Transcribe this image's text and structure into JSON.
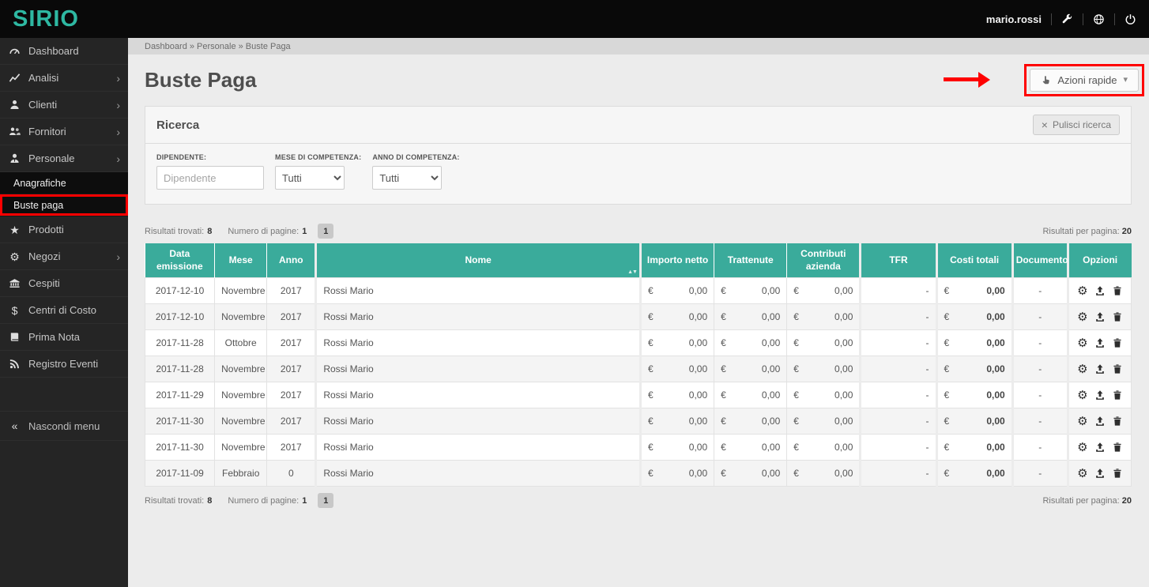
{
  "colors": {
    "accent": "#2eb8a2",
    "table_header": "#3aab9b",
    "annotation": "#fe0000",
    "topbar": "#090909",
    "sidebar": "#252525"
  },
  "topbar": {
    "logo": "SIRIO",
    "username": "mario.rossi",
    "icons": [
      "wrench",
      "globe",
      "power"
    ]
  },
  "breadcrumb": {
    "text": "Dashboard » Personale » Buste Paga"
  },
  "sidebar": {
    "items": [
      {
        "label": "Dashboard",
        "icon": "dashboard"
      },
      {
        "label": "Analisi",
        "icon": "chart",
        "chevron": true
      },
      {
        "label": "Clienti",
        "icon": "user",
        "chevron": true
      },
      {
        "label": "Fornitori",
        "icon": "users",
        "chevron": true
      },
      {
        "label": "Personale",
        "icon": "user-tie",
        "chevron": true
      },
      {
        "label": "Anagrafiche",
        "sub": true
      },
      {
        "label": "Buste paga",
        "sub": true,
        "active": true,
        "annotated": true
      },
      {
        "label": "Prodotti",
        "icon": "star"
      },
      {
        "label": "Negozi",
        "icon": "gears",
        "chevron": true
      },
      {
        "label": "Cespiti",
        "icon": "bank"
      },
      {
        "label": "Centri di Costo",
        "icon": "dollar"
      },
      {
        "label": "Prima Nota",
        "icon": "book"
      },
      {
        "label": "Registro Eventi",
        "icon": "rss"
      }
    ],
    "collapse_label": "Nascondi menu",
    "collapse_icon": "angles-left"
  },
  "page": {
    "title": "Buste Paga",
    "quick_actions_label": "Azioni rapide",
    "quick_actions_icon": "hand"
  },
  "search": {
    "title": "Ricerca",
    "clear_label": "Pulisci ricerca",
    "clear_icon": "x",
    "fields": [
      {
        "label": "DIPENDENTE:",
        "placeholder": "Dipendente",
        "type": "text"
      },
      {
        "label": "MESE DI COMPETENZA:",
        "value": "Tutti",
        "type": "select"
      },
      {
        "label": "ANNO DI COMPETENZA:",
        "value": "Tutti",
        "type": "select"
      }
    ]
  },
  "results": {
    "found_label": "Risultati trovati:",
    "found_value": "8",
    "pages_label": "Numero di pagine:",
    "pages_value": "1",
    "page_button": "1",
    "per_page_label": "Risultati per pagina:",
    "per_page_value": "20"
  },
  "table": {
    "currency": "€",
    "option_icons": [
      "gear",
      "upload",
      "trash"
    ],
    "headers": [
      {
        "label": "Data emissione"
      },
      {
        "label": "Mese"
      },
      {
        "label": "Anno"
      },
      {
        "label": "Nome",
        "sortable": true,
        "sort_glyphs": "▲▼"
      },
      {
        "label": "Importo netto"
      },
      {
        "label": "Trattenute"
      },
      {
        "label": "Contributi azienda"
      },
      {
        "label": "TFR"
      },
      {
        "label": "Costi totali"
      },
      {
        "label": "Documento"
      },
      {
        "label": "Opzioni"
      }
    ],
    "rows": [
      {
        "data_emissione": "2017-12-10",
        "mese": "Novembre",
        "anno": "2017",
        "nome": "Rossi Mario",
        "importo_netto": "0,00",
        "trattenute": "0,00",
        "contributi_azienda": "0,00",
        "tfr": "-",
        "costi_totali": "0,00",
        "documento": "-"
      },
      {
        "data_emissione": "2017-12-10",
        "mese": "Novembre",
        "anno": "2017",
        "nome": "Rossi Mario",
        "importo_netto": "0,00",
        "trattenute": "0,00",
        "contributi_azienda": "0,00",
        "tfr": "-",
        "costi_totali": "0,00",
        "documento": "-"
      },
      {
        "data_emissione": "2017-11-28",
        "mese": "Ottobre",
        "anno": "2017",
        "nome": "Rossi Mario",
        "importo_netto": "0,00",
        "trattenute": "0,00",
        "contributi_azienda": "0,00",
        "tfr": "-",
        "costi_totali": "0,00",
        "documento": "-"
      },
      {
        "data_emissione": "2017-11-28",
        "mese": "Novembre",
        "anno": "2017",
        "nome": "Rossi Mario",
        "importo_netto": "0,00",
        "trattenute": "0,00",
        "contributi_azienda": "0,00",
        "tfr": "-",
        "costi_totali": "0,00",
        "documento": "-"
      },
      {
        "data_emissione": "2017-11-29",
        "mese": "Novembre",
        "anno": "2017",
        "nome": "Rossi Mario",
        "importo_netto": "0,00",
        "trattenute": "0,00",
        "contributi_azienda": "0,00",
        "tfr": "-",
        "costi_totali": "0,00",
        "documento": "-"
      },
      {
        "data_emissione": "2017-11-30",
        "mese": "Novembre",
        "anno": "2017",
        "nome": "Rossi Mario",
        "importo_netto": "0,00",
        "trattenute": "0,00",
        "contributi_azienda": "0,00",
        "tfr": "-",
        "costi_totali": "0,00",
        "documento": "-"
      },
      {
        "data_emissione": "2017-11-30",
        "mese": "Novembre",
        "anno": "2017",
        "nome": "Rossi Mario",
        "importo_netto": "0,00",
        "trattenute": "0,00",
        "contributi_azienda": "0,00",
        "tfr": "-",
        "costi_totali": "0,00",
        "documento": "-"
      },
      {
        "data_emissione": "2017-11-09",
        "mese": "Febbraio",
        "anno": "0",
        "nome": "Rossi Mario",
        "importo_netto": "0,00",
        "trattenute": "0,00",
        "contributi_azienda": "0,00",
        "tfr": "-",
        "costi_totali": "0,00",
        "documento": "-"
      }
    ]
  }
}
